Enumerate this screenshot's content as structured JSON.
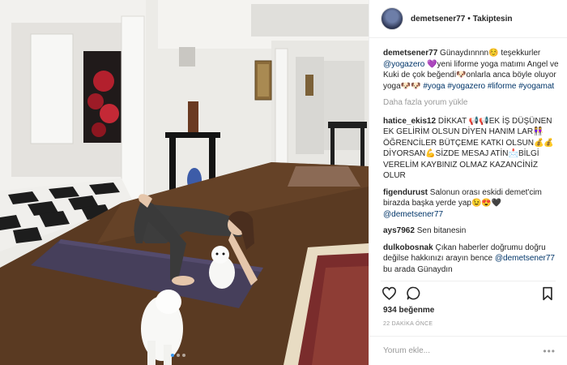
{
  "post": {
    "username": "demetsener77",
    "separator": "•",
    "follow_status": "Takiptesin",
    "carousel_total": 3,
    "carousel_active": 1
  },
  "caption": {
    "user": "demetsener77",
    "text_1": " Günaydınnnn☺️ teşekkurler ",
    "tag_yogazero": "@yogazero",
    "text_2": " 💜yeni liforme yoga matımı Angel ve Kuki de çok beğendi🐶onlarla anca böyle oluyor yoga🐶🐶",
    "hashtag_yoga": "#yoga",
    "hashtag_yogazero": "#yogazero",
    "hashtag_liforme": "#liforme",
    "hashtag_yogamat": "#yogamat"
  },
  "load_more": "Daha fazla yorum yükle",
  "comments": [
    {
      "user": "hatice_ekis12",
      "text": " DİKKAT 📢📢EK İŞ DÜŞÜNEN EK GELİRİM OLSUN DİYEN HANIM LAR👭ÖĞRENCİLER BÜTÇEME KATKI OLSUN💰💰DİYORSAN💪SİZDE MESAJ ATİN📩BİLGİ VERELİM KAYBINIZ OLMAZ KAZANCİNİZ OLUR"
    },
    {
      "user": "figendurust",
      "text": " Salonun orası eskidi demet'cim birazda başka yerde yap😉😍🖤",
      "mention": "@demetsener77"
    },
    {
      "user": "ays7962",
      "text": " Sen bitanesin"
    },
    {
      "user": "dulkobosnak",
      "text": " Çıkan haberler doğrumu doğru değilse hakkınızı arayın bence",
      "mention": "@demetsener77",
      "trailing": " bu arada Günaydın"
    }
  ],
  "likes": "934 beğenme",
  "timestamp": "22 DAKİKA ÖNCE",
  "comment_input": {
    "placeholder": "Yorum ekle..."
  },
  "more_label": "•••",
  "colors": {
    "link": "#003569",
    "muted": "#999999",
    "text": "#262626",
    "carousel_active": "#3897f0"
  },
  "icons": [
    "heart-icon",
    "comment-icon",
    "bookmark-icon",
    "more-options-icon"
  ]
}
